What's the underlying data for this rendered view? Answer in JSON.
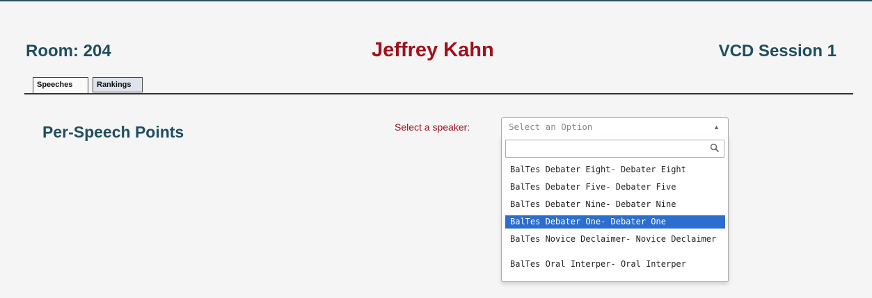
{
  "header": {
    "room": "Room: 204",
    "judge": "Jeffrey Kahn",
    "session": "VCD Session 1"
  },
  "tabs": [
    {
      "label": "Speeches",
      "active": true
    },
    {
      "label": "Rankings",
      "active": false
    }
  ],
  "main": {
    "section_title": "Per-Speech Points",
    "select_label": "Select a speaker:",
    "select_placeholder": "Select an Option",
    "search_value": "",
    "options": [
      "BalTes Debater Eight- Debater Eight",
      "BalTes Debater Five- Debater Five",
      "BalTes Debater Nine- Debater Nine",
      "BalTes Debater One- Debater One",
      "BalTes Novice Declaimer- Novice Declaimer",
      "BalTes Oral Interper- Oral Interper"
    ],
    "highlighted_option": "BalTes Debater One- Debater One"
  },
  "colors": {
    "title_teal": "#1f4d5f",
    "judge_red": "#a1101a",
    "highlight_blue": "#2b6ecf"
  },
  "icons": [
    "search-icon",
    "dropdown-arrow-icon"
  ]
}
